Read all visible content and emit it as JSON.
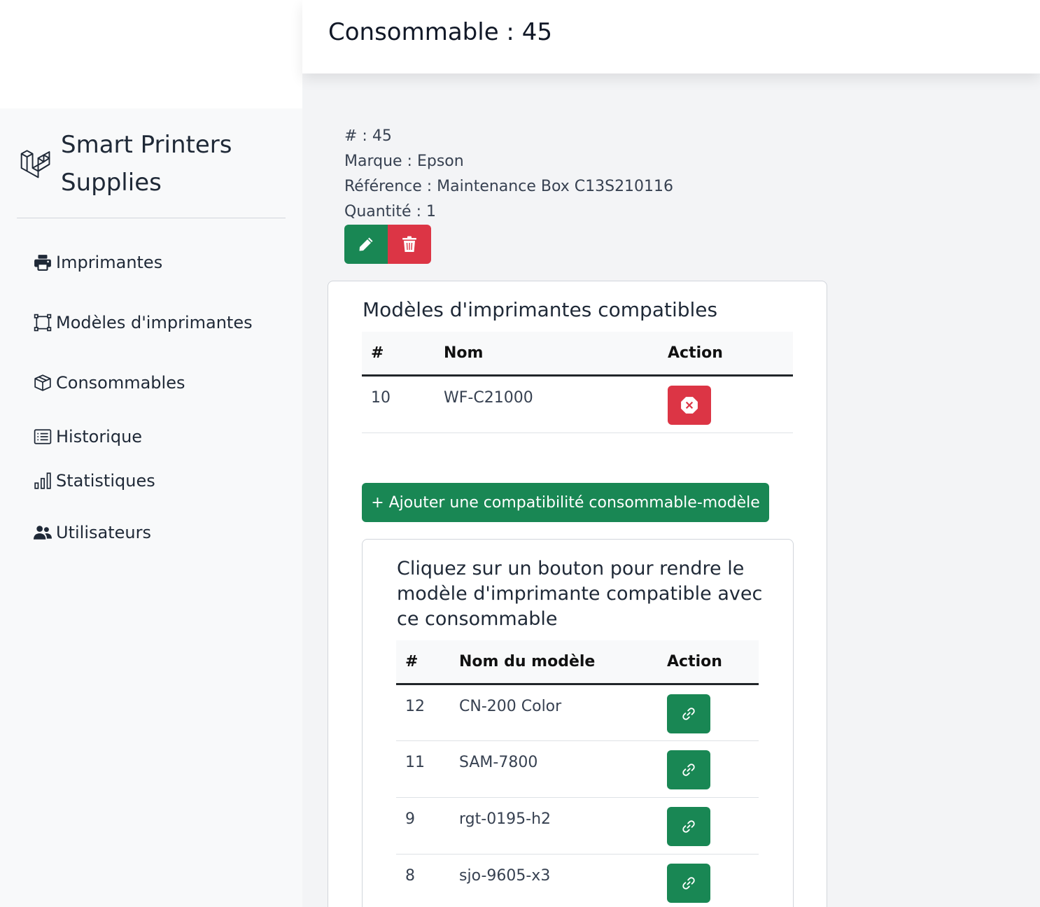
{
  "brand": {
    "name": "Smart Printers Supplies",
    "logo_icon": "laravel-logo-icon"
  },
  "nav": {
    "items": [
      {
        "label": "Imprimantes",
        "icon": "printer-icon"
      },
      {
        "label": "Modèles d'imprimantes",
        "icon": "bounding-box-icon"
      },
      {
        "label": "Consommables",
        "icon": "box-icon"
      },
      {
        "label": "Historique",
        "icon": "list-icon"
      },
      {
        "label": "Statistiques",
        "icon": "bar-chart-icon"
      },
      {
        "label": "Utilisateurs",
        "icon": "people-icon"
      }
    ]
  },
  "header": {
    "title": "Consommable : 45"
  },
  "consumable": {
    "id_line": "# : 45",
    "brand_line": "Marque : Epson",
    "reference_line": "Référence : Maintenance Box C13S210116",
    "quantity_line": "Quantité : 1"
  },
  "compatible": {
    "title": "Modèles d'imprimantes compatibles",
    "headers": [
      "#",
      "Nom",
      "Action"
    ],
    "rows": [
      {
        "id": "10",
        "name": "WF-C21000"
      }
    ]
  },
  "add_button_label": "+ Ajouter une compatibilité consommable-modèle",
  "available": {
    "title": "Cliquez sur un bouton pour rendre le modèle d'imprimante compatible avec ce consommable",
    "headers": [
      "#",
      "Nom du modèle",
      "Action"
    ],
    "rows": [
      {
        "id": "12",
        "name": "CN-200 Color"
      },
      {
        "id": "11",
        "name": "SAM-7800"
      },
      {
        "id": "9",
        "name": "rgt-0195-h2"
      },
      {
        "id": "8",
        "name": "sjo-9605-x3"
      }
    ]
  },
  "colors": {
    "success": "#198754",
    "danger": "#dc3545"
  }
}
